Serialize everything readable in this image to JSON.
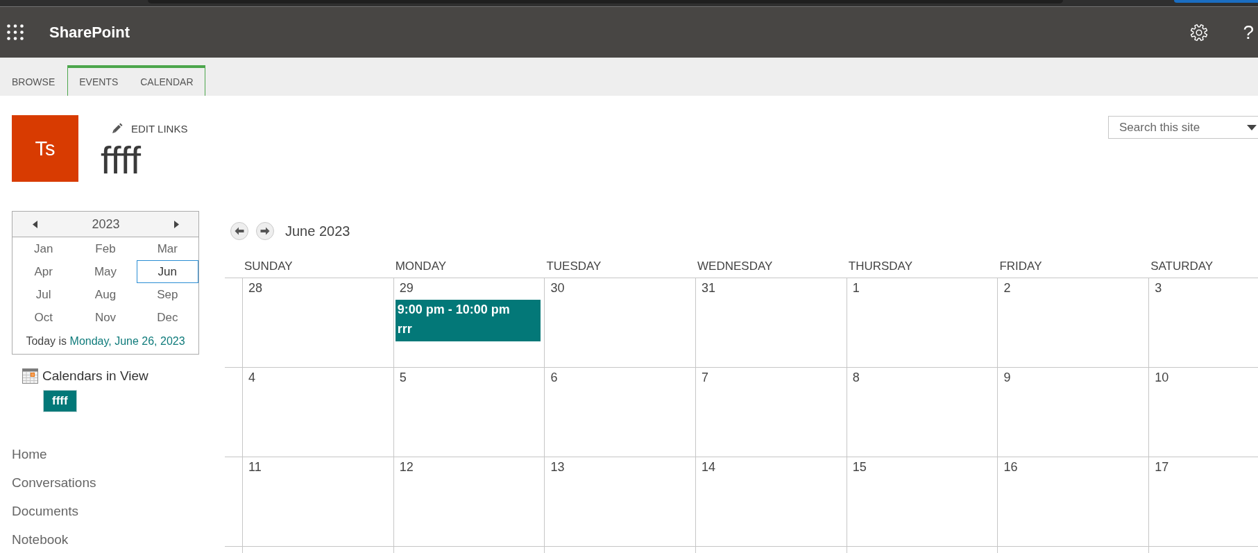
{
  "suite_bar": {
    "title": "SharePoint",
    "help": "?"
  },
  "ribbon": {
    "tabs": [
      {
        "label": "BROWSE",
        "selected": false
      }
    ],
    "tool_tabs": [
      {
        "label": "EVENTS",
        "selected": false
      },
      {
        "label": "CALENDAR",
        "selected": false
      }
    ]
  },
  "site": {
    "logo_text": "Ts",
    "edit_links": "EDIT LINKS",
    "title": "ffff"
  },
  "search": {
    "placeholder": "Search this site"
  },
  "year_picker": {
    "year": "2023",
    "months": [
      {
        "label": "Jan",
        "selected": false
      },
      {
        "label": "Feb",
        "selected": false
      },
      {
        "label": "Mar",
        "selected": false
      },
      {
        "label": "Apr",
        "selected": false
      },
      {
        "label": "May",
        "selected": false
      },
      {
        "label": "Jun",
        "selected": true
      },
      {
        "label": "Jul",
        "selected": false
      },
      {
        "label": "Aug",
        "selected": false
      },
      {
        "label": "Sep",
        "selected": false
      },
      {
        "label": "Oct",
        "selected": false
      },
      {
        "label": "Nov",
        "selected": false
      },
      {
        "label": "Dec",
        "selected": false
      }
    ],
    "today_label": "Today is",
    "today_date": "Monday, June 26, 2023"
  },
  "calendars_in_view": {
    "title": "Calendars in View",
    "calendars": [
      "ffff"
    ]
  },
  "quick_launch": {
    "items": [
      "Home",
      "Conversations",
      "Documents",
      "Notebook"
    ]
  },
  "calendar": {
    "title": "June 2023",
    "weekdays": [
      "SUNDAY",
      "MONDAY",
      "TUESDAY",
      "WEDNESDAY",
      "THURSDAY",
      "FRIDAY",
      "SATURDAY"
    ],
    "weeks": [
      {
        "days": [
          {
            "day": "28"
          },
          {
            "day": "29",
            "events": [
              {
                "time": "9:00 pm - 10:00 pm",
                "title": "rrr"
              }
            ]
          },
          {
            "day": "30"
          },
          {
            "day": "31"
          },
          {
            "day": "1"
          },
          {
            "day": "2"
          },
          {
            "day": "3"
          }
        ]
      },
      {
        "days": [
          {
            "day": "4"
          },
          {
            "day": "5"
          },
          {
            "day": "6"
          },
          {
            "day": "7"
          },
          {
            "day": "8"
          },
          {
            "day": "9"
          },
          {
            "day": "10"
          }
        ]
      },
      {
        "days": [
          {
            "day": "11"
          },
          {
            "day": "12"
          },
          {
            "day": "13"
          },
          {
            "day": "14"
          },
          {
            "day": "15"
          },
          {
            "day": "16"
          },
          {
            "day": "17"
          }
        ]
      }
    ]
  }
}
